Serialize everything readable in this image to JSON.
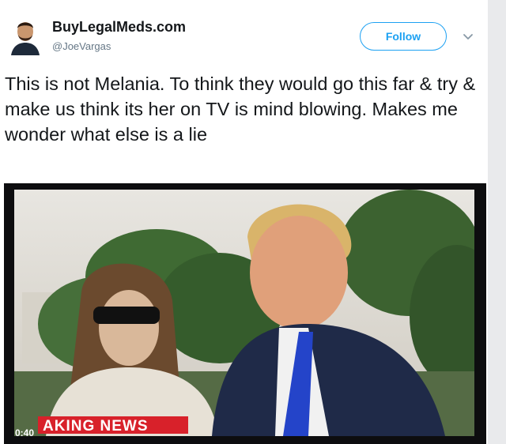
{
  "tweet": {
    "display_name": "BuyLegalMeds.com",
    "handle": "@JoeVargas",
    "follow_label": "Follow",
    "text": "This is not Melania. To think they would go this far & try & make us think its her on TV is mind blowing. Makes me wonder what else is a lie"
  },
  "video": {
    "timestamp": "0:40",
    "banner_text": "AKING NEWS"
  },
  "colors": {
    "accent": "#1da1f2",
    "banner_red": "#d8212a"
  }
}
